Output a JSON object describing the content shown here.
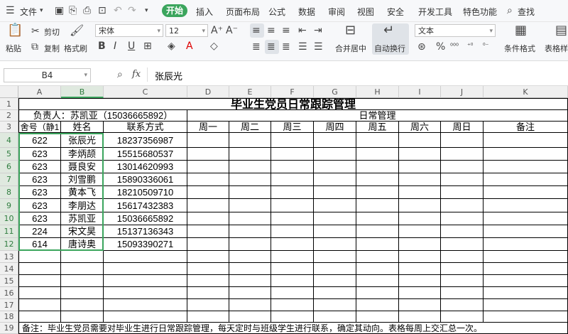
{
  "menubar": {
    "file": "文件",
    "tabs": [
      "开始",
      "插入",
      "页面布局",
      "公式",
      "数据",
      "审阅",
      "视图",
      "安全",
      "开发工具",
      "特色功能"
    ],
    "search": "查找"
  },
  "ribbon": {
    "paste": "粘贴",
    "cut": "剪切",
    "copy": "复制",
    "format_painter": "格式刷",
    "font_name": "宋体",
    "font_size": "12",
    "merge_center": "合并居中",
    "wrap_text": "自动换行",
    "number_format": "文本",
    "conditional_format": "条件格式",
    "table_style": "表格样式"
  },
  "formula_bar": {
    "cell_ref": "B4",
    "fx": "fx",
    "value": "张辰光"
  },
  "columns": [
    "A",
    "B",
    "C",
    "D",
    "E",
    "F",
    "G",
    "H",
    "I",
    "J",
    "K"
  ],
  "rows": [
    "1",
    "2",
    "3",
    "4",
    "5",
    "6",
    "7",
    "8",
    "9",
    "10",
    "11",
    "12",
    "13",
    "14",
    "15",
    "16",
    "17",
    "18",
    "19"
  ],
  "sheet": {
    "title": "毕业生党员日常跟踪管理",
    "responsible": "负责人：苏凯亚（15036665892）",
    "daily_mgmt": "日常管理",
    "headers": [
      "舍号（静1",
      "姓名",
      "联系方式",
      "周一",
      "周二",
      "周三",
      "周四",
      "周五",
      "周六",
      "周日",
      "备注"
    ],
    "records": [
      [
        "622",
        "张辰光",
        "18237356987"
      ],
      [
        "623",
        "李炳颉",
        "15515680537"
      ],
      [
        "623",
        "聂良安",
        "13014620993"
      ],
      [
        "623",
        "刘雪鹏",
        "15890336061"
      ],
      [
        "623",
        "黄本飞",
        "18210509710"
      ],
      [
        "623",
        "李朋达",
        "15617432383"
      ],
      [
        "623",
        "苏凯亚",
        "15036665892"
      ],
      [
        "224",
        "宋文昊",
        "15137136343"
      ],
      [
        "614",
        "唐诗奥",
        "15093390271"
      ]
    ],
    "note": "备注：毕业生党员需要对毕业生进行日常跟踪管理，每天定时与班级学生进行联系，确定其动向。表格每周上交汇总一次。"
  }
}
